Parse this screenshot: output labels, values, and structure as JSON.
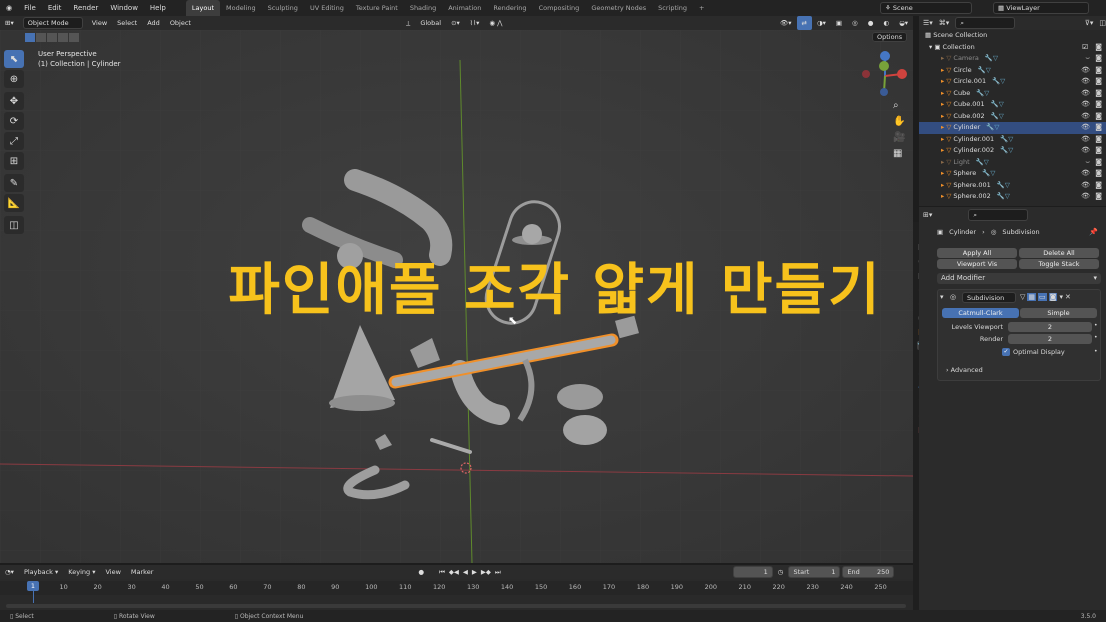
{
  "menus": [
    "File",
    "Edit",
    "Render",
    "Window",
    "Help"
  ],
  "workspaces": [
    {
      "label": "Layout",
      "active": true
    },
    {
      "label": "Modeling",
      "active": false
    },
    {
      "label": "Sculpting",
      "active": false
    },
    {
      "label": "UV Editing",
      "active": false
    },
    {
      "label": "Texture Paint",
      "active": false
    },
    {
      "label": "Shading",
      "active": false
    },
    {
      "label": "Animation",
      "active": false
    },
    {
      "label": "Rendering",
      "active": false
    },
    {
      "label": "Compositing",
      "active": false
    },
    {
      "label": "Geometry Nodes",
      "active": false
    },
    {
      "label": "Scripting",
      "active": false
    }
  ],
  "add_tab": "+",
  "scene": "Scene",
  "view_layer": "ViewLayer",
  "viewport_header": {
    "mode": "Object Mode",
    "items": [
      "View",
      "Select",
      "Add",
      "Object"
    ],
    "orientation": "Global",
    "options": "Options"
  },
  "viewport": {
    "perspective": "User Perspective",
    "collection_info": "(1) Collection | Cylinder",
    "overlay_title": "파인애플 조각 얇게 만들기",
    "gizmo_axes": {
      "x": "X",
      "y": "Y",
      "z": "Z"
    }
  },
  "outliner": {
    "root": "Scene Collection",
    "collection": "Collection",
    "items": [
      {
        "name": "Camera",
        "selected": false,
        "dim": true
      },
      {
        "name": "Circle",
        "selected": false,
        "dim": false
      },
      {
        "name": "Circle.001",
        "selected": false,
        "dim": false
      },
      {
        "name": "Cube",
        "selected": false,
        "dim": false
      },
      {
        "name": "Cube.001",
        "selected": false,
        "dim": false
      },
      {
        "name": "Cube.002",
        "selected": false,
        "dim": false
      },
      {
        "name": "Cylinder",
        "selected": true,
        "dim": false
      },
      {
        "name": "Cylinder.001",
        "selected": false,
        "dim": false
      },
      {
        "name": "Cylinder.002",
        "selected": false,
        "dim": false
      },
      {
        "name": "Light",
        "selected": false,
        "dim": true
      },
      {
        "name": "Sphere",
        "selected": false,
        "dim": false
      },
      {
        "name": "Sphere.001",
        "selected": false,
        "dim": false
      },
      {
        "name": "Sphere.002",
        "selected": false,
        "dim": false
      }
    ]
  },
  "properties": {
    "object": "Cylinder",
    "modifier_path": "Subdivision",
    "apply_all": "Apply All",
    "delete_all": "Delete All",
    "viewport_vis": "Viewport Vis",
    "toggle_stack": "Toggle Stack",
    "add_modifier": "Add Modifier",
    "modifier_name": "Subdivision",
    "mode_catmull": "Catmull-Clark",
    "mode_simple": "Simple",
    "levels_viewport_label": "Levels Viewport",
    "levels_viewport": "2",
    "render_label": "Render",
    "render": "2",
    "optimal_display": "Optimal Display",
    "advanced": "Advanced"
  },
  "timeline": {
    "menus": [
      "Playback",
      "Keying",
      "View",
      "Marker"
    ],
    "current_frame": "1",
    "start_label": "Start",
    "start": "1",
    "end_label": "End",
    "end": "250",
    "ticks": [
      "1",
      "10",
      "20",
      "30",
      "40",
      "50",
      "60",
      "70",
      "80",
      "90",
      "100",
      "110",
      "120",
      "130",
      "140",
      "150",
      "160",
      "170",
      "180",
      "190",
      "200",
      "210",
      "220",
      "230",
      "240",
      "250"
    ]
  },
  "status": {
    "select": "Select",
    "rotate": "Rotate View",
    "context": "Object Context Menu",
    "version": "3.5.0"
  },
  "colors": {
    "accent": "#4772b3",
    "title": "#f7c21c",
    "selection_outline": "#f0902a"
  }
}
